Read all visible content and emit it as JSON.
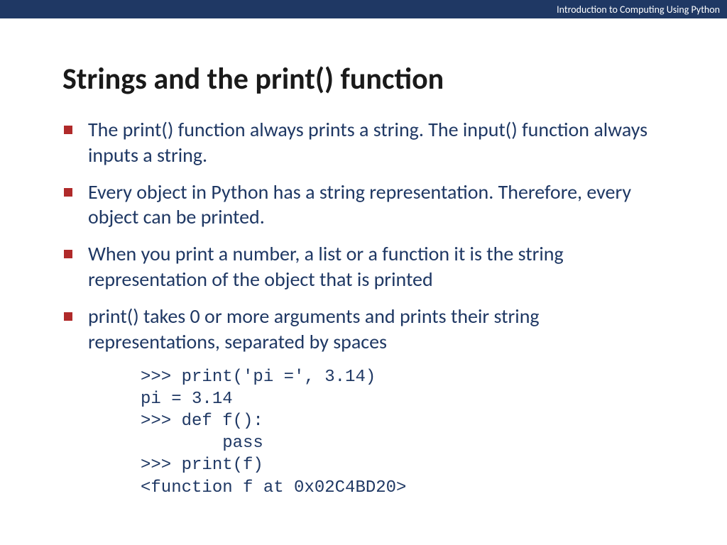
{
  "header": {
    "course_label": "Introduction to Computing Using Python"
  },
  "slide": {
    "title": "Strings and the print() function",
    "bullets": [
      "The print() function always prints a string. The input() function always inputs a string.",
      "Every object in Python has a string representation. Therefore, every object can be printed.",
      "When you print a number, a list or a function it is the string representation of the object that is printed",
      "print() takes 0 or more arguments and prints their string representations, separated by spaces"
    ],
    "code": ">>> print('pi =', 3.14)\npi = 3.14\n>>> def f():\n        pass\n>>> print(f)\n<function f at 0x02C4BD20>"
  }
}
